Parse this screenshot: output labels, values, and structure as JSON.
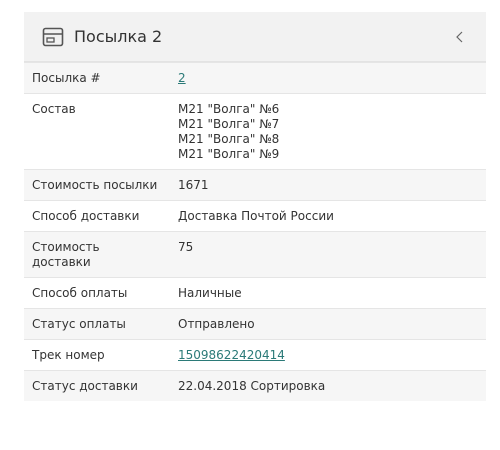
{
  "panel": {
    "title": "Посылка 2",
    "collapse_glyph": "‹",
    "icon": "package-box-icon"
  },
  "rows": {
    "parcel_no": {
      "label": "Посылка #",
      "value": "2"
    },
    "composition": {
      "label": "Состав",
      "items": [
        "M21 \"Волга\" №6",
        "M21 \"Волга\" №7",
        "M21 \"Волга\" №8",
        "M21 \"Волга\" №9"
      ]
    },
    "parcel_cost": {
      "label": "Стоимость посылки",
      "value": "1671"
    },
    "delivery_method": {
      "label": "Способ доставки",
      "value": "Доставка Почтой России"
    },
    "delivery_cost": {
      "label": "Стоимость доставки",
      "value": "75"
    },
    "payment_method": {
      "label": "Способ оплаты",
      "value": "Наличные"
    },
    "payment_status": {
      "label": "Статус оплаты",
      "value": "Отправлено"
    },
    "tracking_no": {
      "label": "Трек номер",
      "value": "15098622420414"
    },
    "delivery_status": {
      "label": "Статус доставки",
      "value": "22.04.2018 Сортировка"
    }
  },
  "colors": {
    "link": "#2b7a78",
    "header_bg": "#f2f2f2",
    "row_alt_bg": "#f6f6f6"
  }
}
